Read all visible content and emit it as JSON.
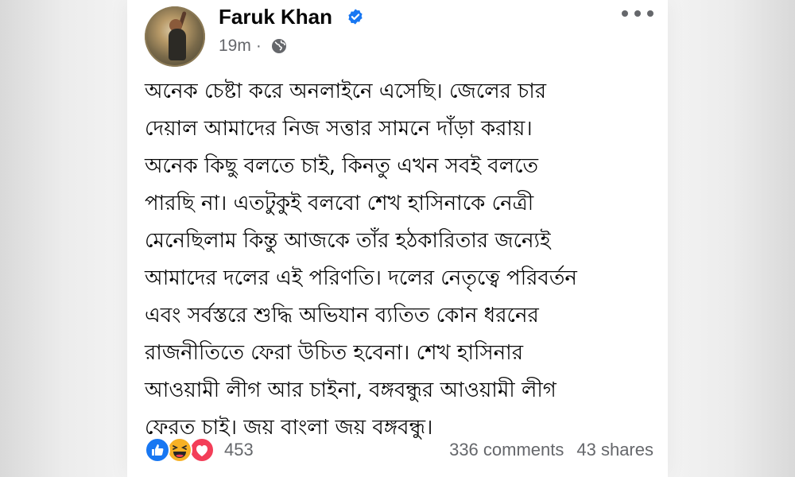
{
  "post": {
    "author": "Faruk Khan",
    "verified_icon": "verified-badge-icon",
    "time": "19m",
    "audience_icon": "globe-icon",
    "body_lines": [
      "অনেক চেষ্টা করে অনলাইনে এসেছি। জেলের চার",
      "দেয়াল আমাদের নিজ সত্তার সামনে দাঁড়া করায়।",
      "অনেক কিছু বলতে চাই, কিনতু এখন সবই বলতে",
      "পারছি না। এতটুকুই বলবো শেখ হাসিনাকে নেত্রী",
      "মেনেছিলাম কিন্তু আজকে তাঁর হঠকারিতার জন্যেই",
      "আমাদের দলের এই পরিণতি। দলের নেতৃত্বে পরিবর্তন",
      "এবং সর্বস্তরে শুদ্ধি অভিযান ব্যতিত কোন ধরনের",
      "রাজনীতিতে ফেরা উচিত হবেনা। শেখ হাসিনার",
      "আওয়ামী লীগ আর চাইনা, বঙ্গবন্ধুর আওয়ামী লীগ",
      "ফেরত চাই। জয় বাংলা জয় বঙ্গবন্ধু।"
    ],
    "reactions": {
      "icons": [
        "like-icon",
        "haha-icon",
        "love-icon"
      ],
      "count": "453"
    },
    "comments": "336 comments",
    "shares": "43 shares"
  },
  "colors": {
    "facebook_blue": "#1877f2",
    "love_red": "#f33e58",
    "haha_yellow": "#f7b125",
    "secondary_text": "#65676b"
  }
}
